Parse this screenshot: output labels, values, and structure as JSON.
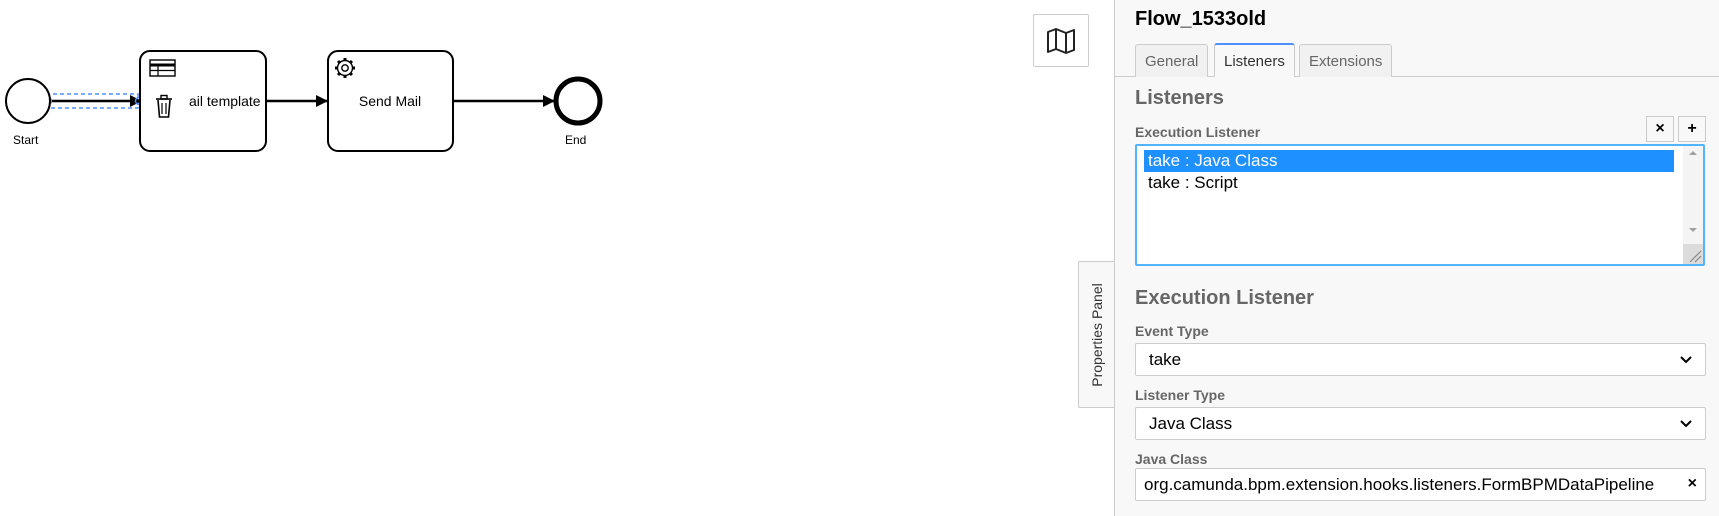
{
  "diagram": {
    "start_event": {
      "label": "Start"
    },
    "task_1": {
      "label": "ail template",
      "icon": "table-icon"
    },
    "task_2": {
      "label": "Send Mail",
      "icon": "gear-icon"
    },
    "end_event": {
      "label": "End"
    },
    "context_pad": {
      "icon": "trash-icon"
    }
  },
  "minimap": {
    "icon": "map-icon"
  },
  "properties_panel": {
    "toggle_label": "Properties Panel",
    "title": "Flow_1533old",
    "tabs": [
      {
        "label": "General"
      },
      {
        "label": "Listeners",
        "active": true
      },
      {
        "label": "Extensions"
      }
    ],
    "listeners_heading": "Listeners",
    "execution_listener_label": "Execution Listener",
    "remove_button": "×",
    "add_button": "+",
    "listener_items": [
      {
        "label": "take : Java Class",
        "selected": true
      },
      {
        "label": "take : Script",
        "selected": false
      }
    ],
    "detail_heading": "Execution Listener",
    "event_type_label": "Event Type",
    "event_type_value": "take",
    "listener_type_label": "Listener Type",
    "listener_type_value": "Java Class",
    "java_class_label": "Java Class",
    "java_class_value": "org.camunda.bpm.extension.hooks.listeners.FormBPMDataPipeline",
    "clear_button": "×"
  },
  "colors": {
    "accent": "#4d90fe",
    "selection": "#1e90ff",
    "list_border": "#52b3ff",
    "panel_bg": "#f8f8f8"
  }
}
